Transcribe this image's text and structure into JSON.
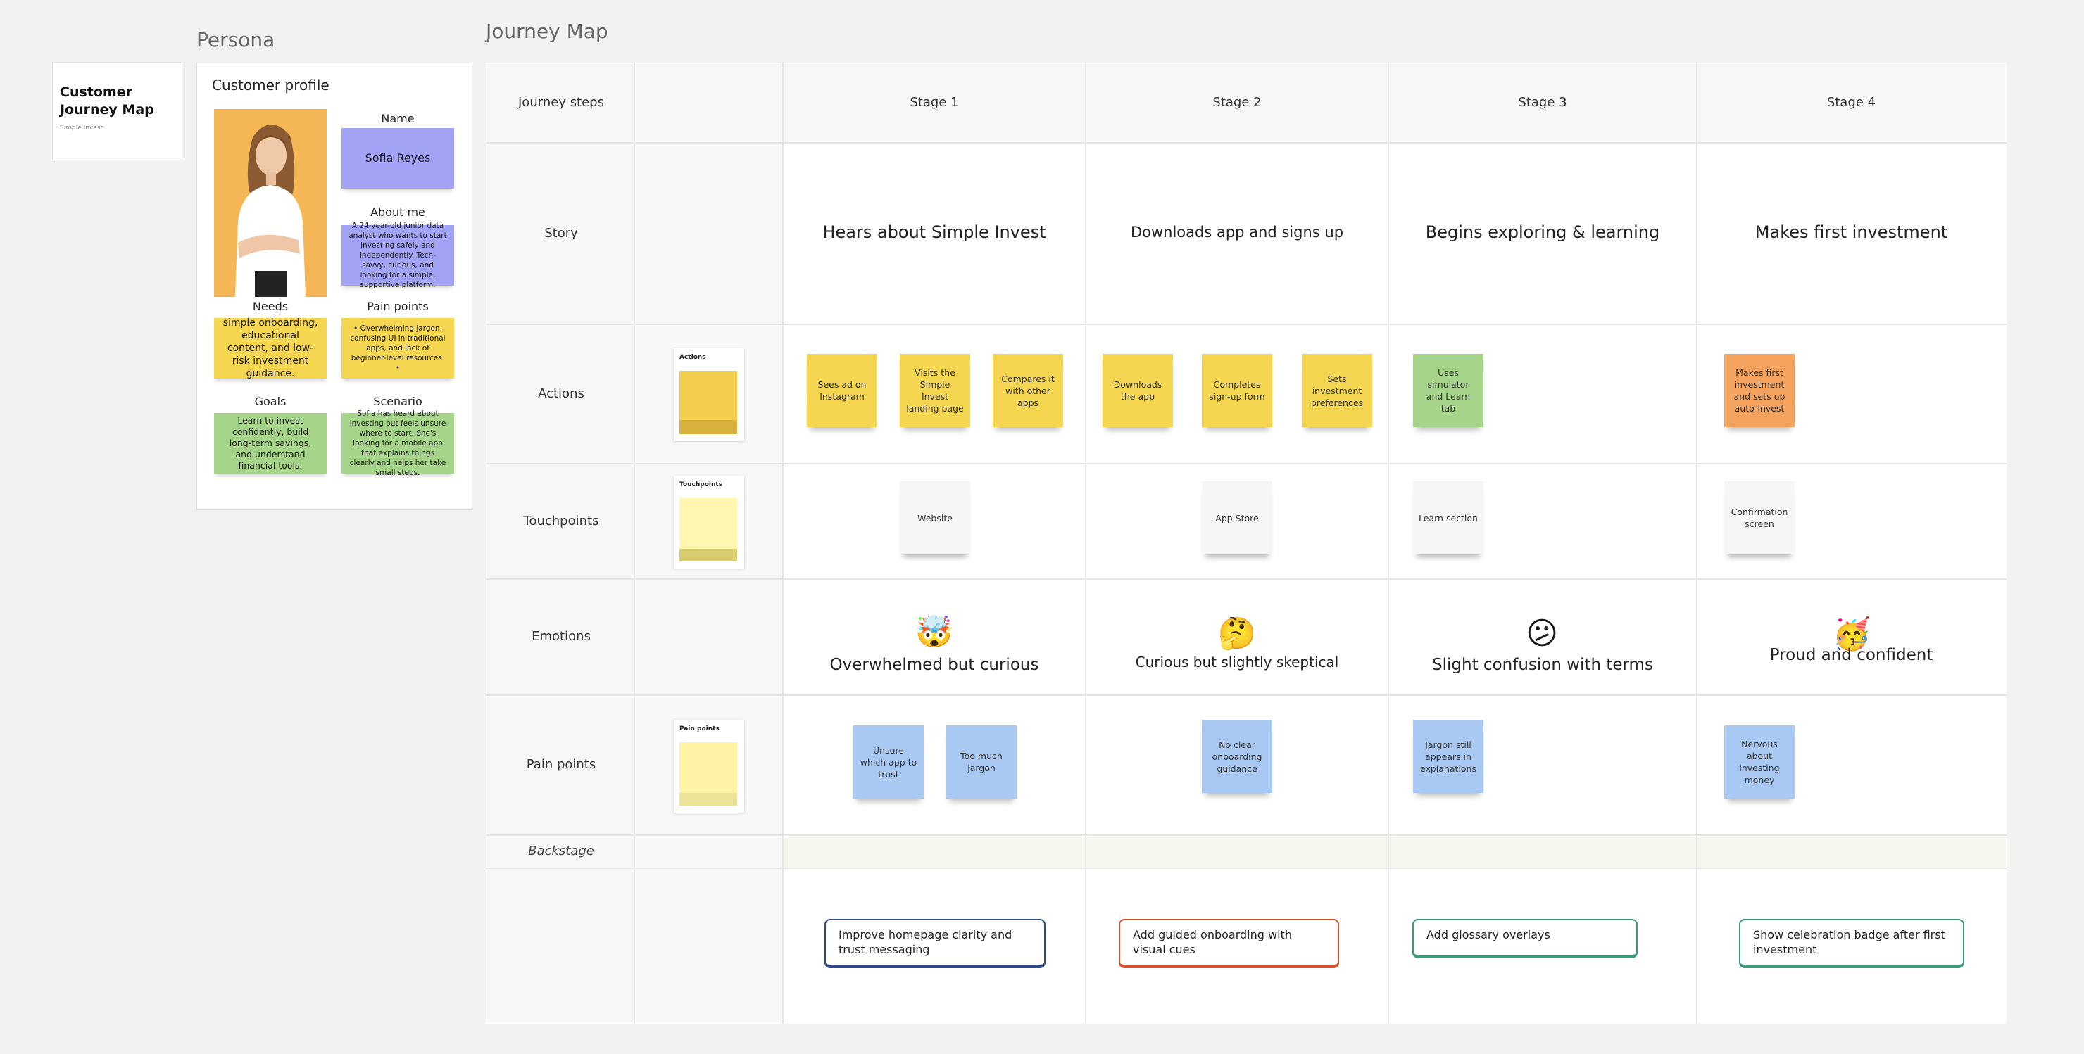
{
  "title_card": {
    "title": "Customer Journey Map",
    "subtitle": "Simple Invest"
  },
  "persona": {
    "section_label": "Persona",
    "card_title": "Customer profile",
    "name_label": "Name",
    "name_value": "Sofia Reyes",
    "about_label": "About me",
    "about_text": "A 24-year-old junior data analyst who wants to start investing safely and independently. Tech-savvy, curious, and looking for a simple, supportive platform.",
    "needs_label": "Needs",
    "needs_text": "simple onboarding, educational content, and low-risk investment guidance.",
    "pain_label": "Pain points",
    "pain_text": "• Overwhelming jargon, confusing UI in traditional apps, and lack of beginner-level resources.\n•",
    "goals_label": "Goals",
    "goals_text": "Learn to invest confidently, build long-term savings, and understand financial tools.",
    "scenario_label": "Scenario",
    "scenario_text": "Sofia has heard about investing but feels unsure where to start. She's looking for a mobile app that explains things clearly and helps her take small steps."
  },
  "journey": {
    "section_label": "Journey Map",
    "row_labels": {
      "steps": "Journey steps",
      "story": "Story",
      "actions": "Actions",
      "touchpoints": "Touchpoints",
      "emotions": "Emotions",
      "pain_points": "Pain points",
      "backstage": "Backstage"
    },
    "templates": {
      "actions": "Actions",
      "touchpoints": "Touchpoints",
      "pain_points": "Pain points"
    },
    "stages": [
      {
        "title": "Stage 1",
        "story": "Hears about Simple Invest",
        "emotion": "Overwhelmed but curious",
        "emoji": "🤯",
        "touchpoint": "Website",
        "improvement": "Improve homepage clarity and trust messaging",
        "improvement_color": "#2f4a8a"
      },
      {
        "title": "Stage 2",
        "story": "Downloads app and signs up",
        "emotion": "Curious but slightly skeptical",
        "emoji": "🤔",
        "touchpoint": "App Store",
        "improvement": "Add guided onboarding with visual cues",
        "improvement_color": "#d9502f"
      },
      {
        "title": "Stage 3",
        "story": "Begins exploring & learning",
        "emotion": "Slight confusion with terms",
        "emoji": "😕",
        "touchpoint": "Learn section",
        "improvement": "Add glossary overlays",
        "improvement_color": "#3f9a7a"
      },
      {
        "title": "Stage 4",
        "story": "Makes first investment",
        "emotion": "Proud and confident",
        "emoji": "🥳",
        "touchpoint": "Confirmation screen",
        "improvement": "Show celebration badge after first investment",
        "improvement_color": "#3f9a7a"
      }
    ],
    "actions": [
      "Sees ad on Instagram",
      "Visits the Simple Invest landing page",
      "Compares it with other apps",
      "Downloads the app",
      "Completes sign-up form",
      "Sets investment preferences",
      "Uses simulator and Learn tab",
      "Makes first investment and sets up auto-invest"
    ],
    "pain_points": [
      "Unsure which app to trust",
      "Too much jargon",
      "No clear onboarding guidance",
      "Jargon still appears in explanations",
      "Nervous about investing money"
    ]
  },
  "colors": {
    "yellow_sticky": "#f5d651",
    "green_sticky": "#a5d48a",
    "orange_sticky": "#f3a35d",
    "blue_sticky": "#a9c8f2",
    "purple_sticky": "#a2a3f4",
    "persona_photo_bg": "#f5b756"
  }
}
